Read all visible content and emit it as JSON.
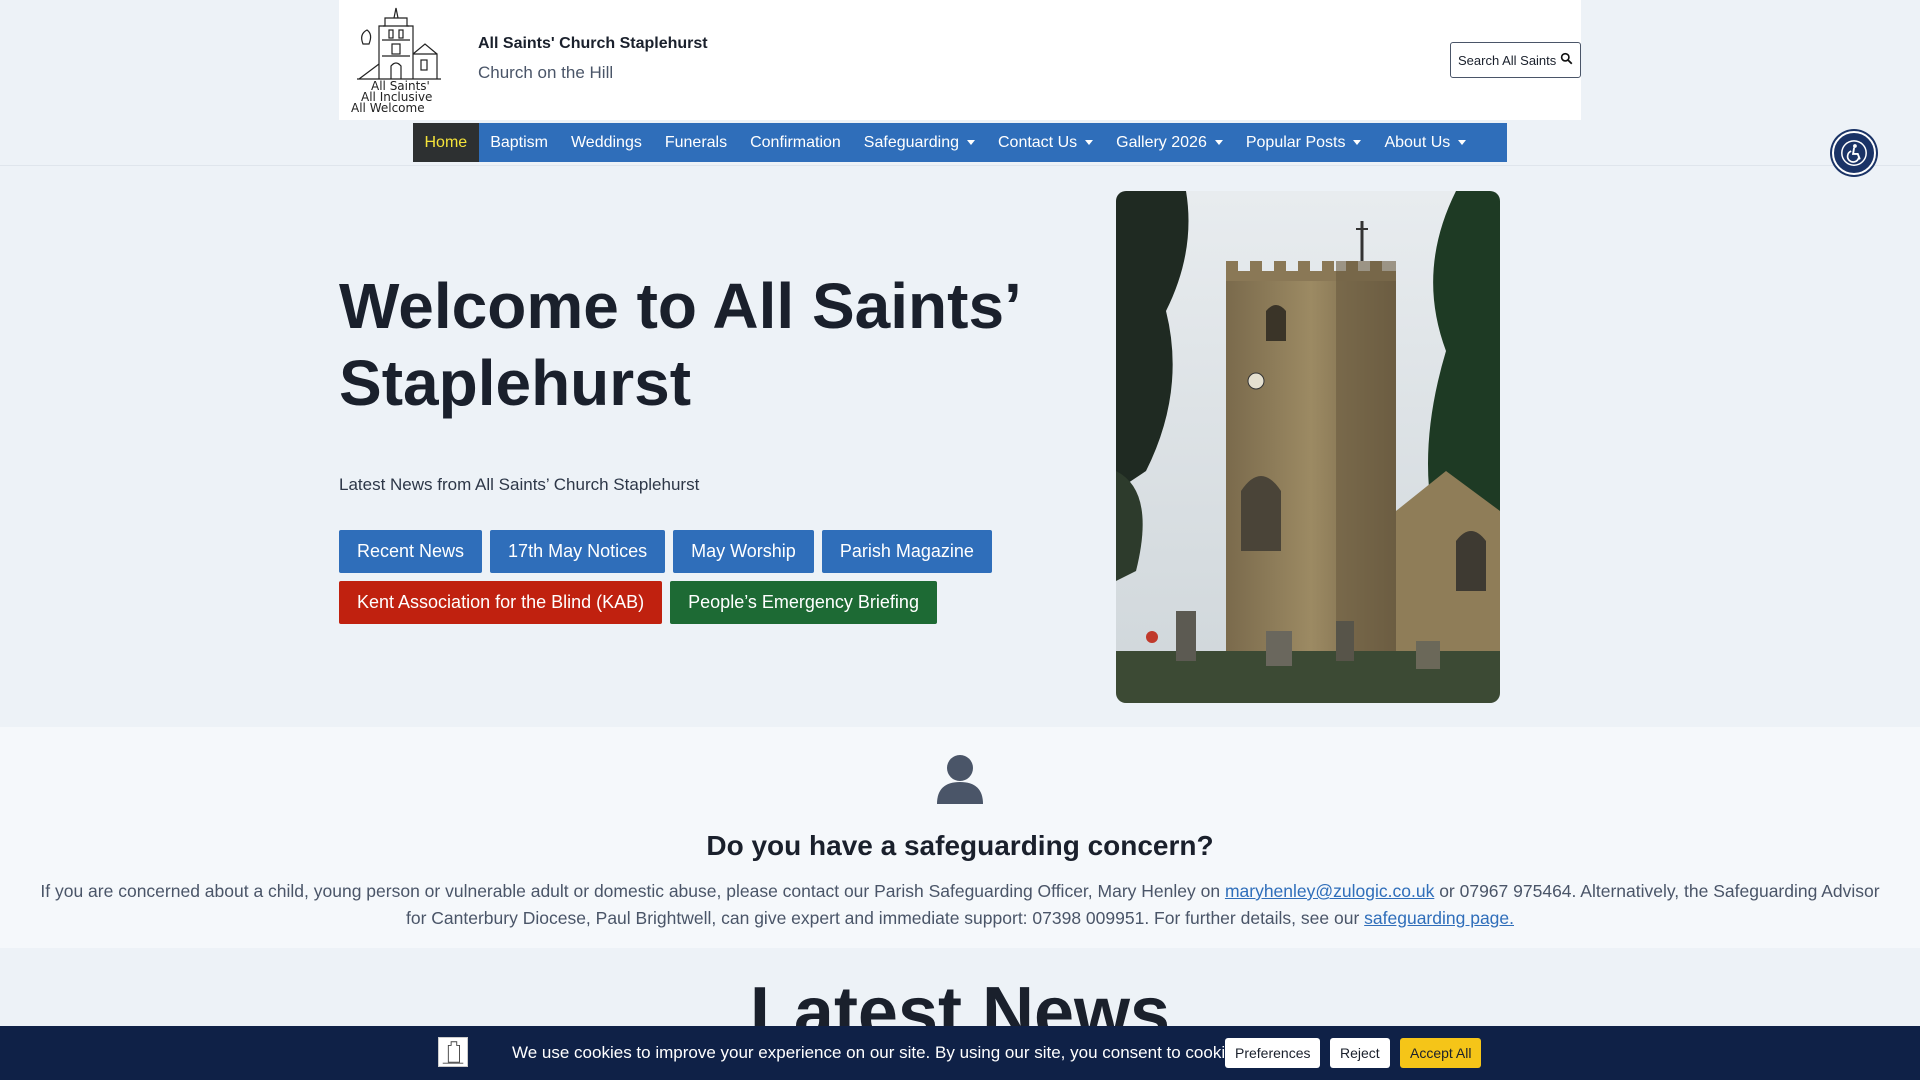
{
  "header": {
    "site_title": "All Saints' Church Staplehurst",
    "tagline": "Church on the Hill",
    "logo_text": [
      "All Saints'",
      "All Inclusive",
      "All Welcome"
    ],
    "search_label": "Search All Saints",
    "search_icon": "search-icon"
  },
  "nav": {
    "items": [
      {
        "label": "Home",
        "active": true
      },
      {
        "label": "Baptism"
      },
      {
        "label": "Weddings"
      },
      {
        "label": "Funerals"
      },
      {
        "label": "Confirmation"
      },
      {
        "label": "Safeguarding",
        "dropdown": true
      },
      {
        "label": "Contact Us",
        "dropdown": true
      },
      {
        "label": "Gallery 2026",
        "dropdown": true
      },
      {
        "label": "Popular Posts",
        "dropdown": true
      },
      {
        "label": "About Us",
        "dropdown": true
      }
    ]
  },
  "accessibility_icon": "accessibility-icon",
  "hero": {
    "title": "Welcome to All Saints’ Staplehurst",
    "subtitle": "Latest News from All Saints’ Church Staplehurst",
    "buttons_row1": [
      "Recent News",
      "17th May Notices",
      "May Worship",
      "Parish Magazine"
    ],
    "buttons_row2": [
      "Kent Association for the Blind (KAB)",
      "People’s Emergency Briefing"
    ]
  },
  "safeguarding": {
    "icon": "person-icon",
    "title": "Do you have a safeguarding concern?",
    "text_1": "If you are concerned about a child, young person or vulnerable adult or domestic abuse, please contact our Parish Safeguarding Officer, Mary Henley on ",
    "email": "maryhenley@zulogic.co.uk",
    "text_2": " or 07967 975464. Alternatively, the Safeguarding Advisor for Canterbury Diocese, Paul Brightwell, can give expert and immediate support: 07398 009951. For further details, see our ",
    "link": "safeguarding page."
  },
  "latest_news_heading": "Latest News",
  "cookie": {
    "text": "We use cookies to improve your experience on our site. By using our site, you consent to cookies.",
    "preferences": "Preferences",
    "reject": "Reject",
    "accept": "Accept All"
  },
  "colors": {
    "nav_bg": "#2f6eba",
    "nav_active_bg": "#2d3031",
    "nav_active_text": "#f5e33a",
    "btn_red": "#c0210f",
    "btn_green": "#1d6a34",
    "cookie_bg": "#0f2147",
    "accept_bg": "#f5c518"
  }
}
